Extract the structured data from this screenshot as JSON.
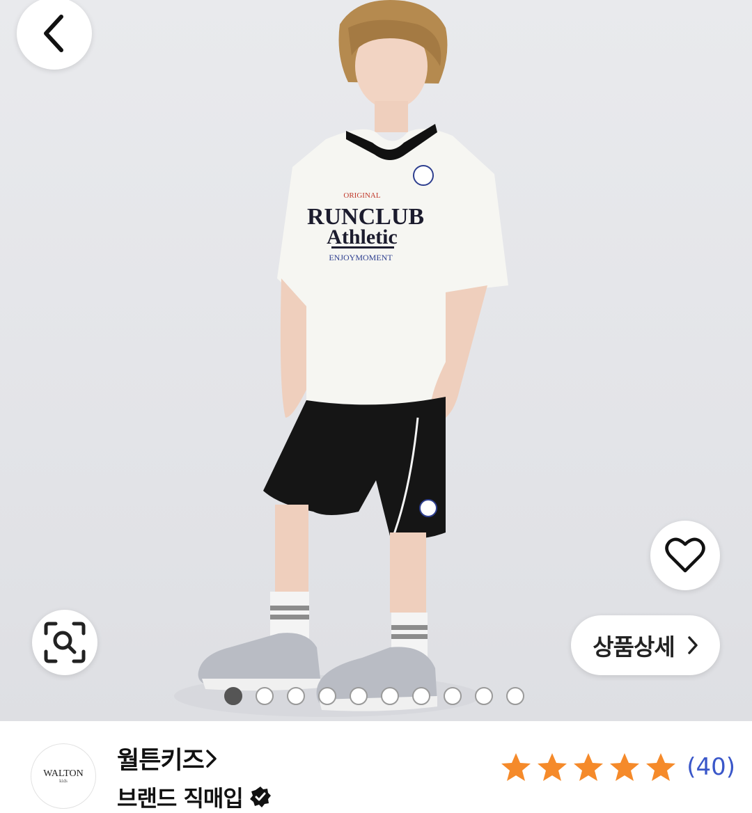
{
  "hero": {
    "image_alt": "Boy wearing RUNCLUB Athletic soccer jersey set",
    "shirt_text": {
      "top": "ORIGINAL",
      "main": "RUNCLUB",
      "second": "Athletic",
      "bottom": "ENJOYMOMENT"
    },
    "slide_count": 10,
    "active_slide": 1
  },
  "buttons": {
    "back_icon": "chevron-left-icon",
    "wishlist_icon": "heart-icon",
    "image_search_icon": "lens-search-icon",
    "detail_label": "상품상세",
    "detail_icon": "chevron-right-icon"
  },
  "brand": {
    "logo_text": "WALTON",
    "logo_sub": "kids",
    "name": "월튼키즈",
    "name_icon": "chevron-right-icon",
    "sub_label": "브랜드 직매입",
    "verified_icon": "verified-badge-icon"
  },
  "rating": {
    "stars": 5,
    "review_count": "(40)",
    "star_color": "#f58a2a"
  }
}
